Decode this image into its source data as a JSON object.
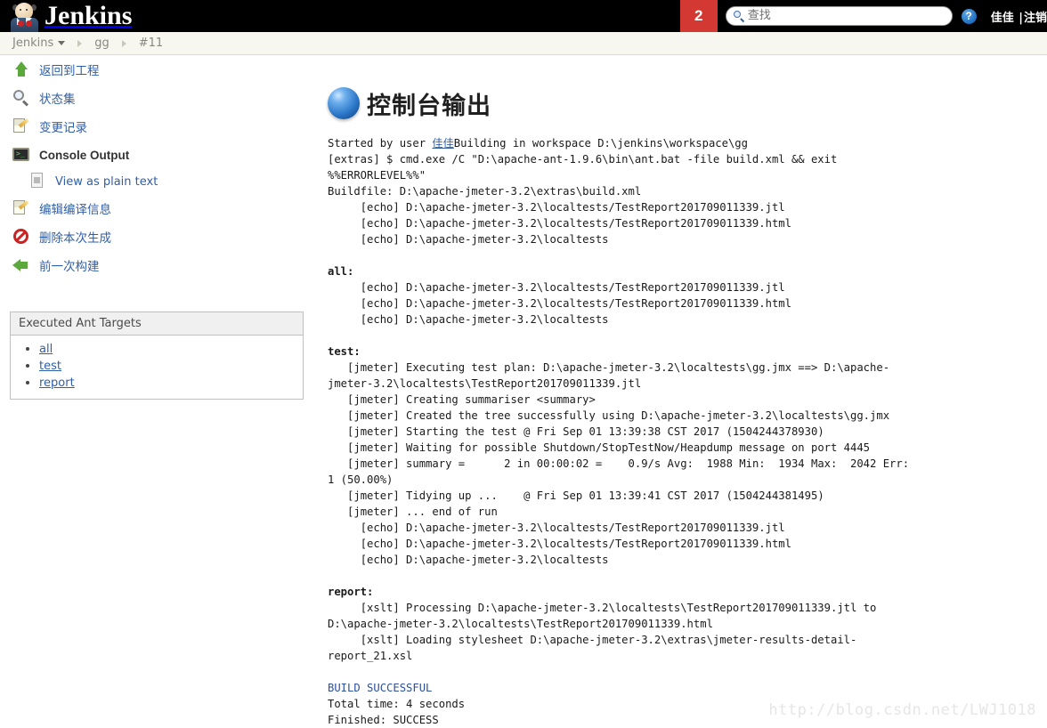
{
  "topbar": {
    "brand": "Jenkins",
    "mascot_icon": "jenkins-butler-icon",
    "build_badge": "2",
    "search_placeholder": "查找",
    "search_value": "",
    "search_icon": "search-icon",
    "help_icon": "question-mark-icon",
    "user_name": "佳佳",
    "separator": "|",
    "logout_label": "注销"
  },
  "breadcrumb": {
    "items": [
      {
        "label": "Jenkins",
        "has_caret": true
      },
      {
        "label": "gg",
        "has_caret": false
      },
      {
        "label": "#11",
        "has_caret": false
      }
    ]
  },
  "sidebar": {
    "tasks": [
      {
        "label": "返回到工程",
        "icon": "up-arrow-icon",
        "current": false
      },
      {
        "label": "状态集",
        "icon": "magnifier-icon",
        "current": false
      },
      {
        "label": "变更记录",
        "icon": "notepad-pencil-icon",
        "current": false
      },
      {
        "label": "Console Output",
        "icon": "console-terminal-icon",
        "current": true
      },
      {
        "label": "View as plain text",
        "icon": "document-icon",
        "current": false,
        "sub": true
      },
      {
        "label": "编辑编译信息",
        "icon": "notepad-pencil-icon",
        "current": false
      },
      {
        "label": "删除本次生成",
        "icon": "prohibit-icon",
        "current": false
      },
      {
        "label": "前一次构建",
        "icon": "left-arrow-icon",
        "current": false
      }
    ],
    "ant_panel": {
      "title": "Executed Ant Targets",
      "targets": [
        "all",
        "test",
        "report"
      ]
    }
  },
  "main": {
    "title": "控制台输出",
    "title_icon": "blue-sphere-icon",
    "console": {
      "started_by_prefix": "Started by user ",
      "started_by_user": "佳佳",
      "lines_1": "Building in workspace D:\\jenkins\\workspace\\gg\n[extras] $ cmd.exe /C \"D:\\apache-ant-1.9.6\\bin\\ant.bat -file build.xml && exit %%ERRORLEVEL%%\"\nBuildfile: D:\\apache-jmeter-3.2\\extras\\build.xml\n     [echo] D:\\apache-jmeter-3.2\\localtests/TestReport201709011339.jtl\n     [echo] D:\\apache-jmeter-3.2\\localtests/TestReport201709011339.html\n     [echo] D:\\apache-jmeter-3.2\\localtests\n",
      "target_all": "all:",
      "lines_all": "\n     [echo] D:\\apache-jmeter-3.2\\localtests/TestReport201709011339.jtl\n     [echo] D:\\apache-jmeter-3.2\\localtests/TestReport201709011339.html\n     [echo] D:\\apache-jmeter-3.2\\localtests\n",
      "target_test": "test:",
      "lines_test": "\n   [jmeter] Executing test plan: D:\\apache-jmeter-3.2\\localtests\\gg.jmx ==> D:\\apache-jmeter-3.2\\localtests\\TestReport201709011339.jtl\n   [jmeter] Creating summariser <summary>\n   [jmeter] Created the tree successfully using D:\\apache-jmeter-3.2\\localtests\\gg.jmx\n   [jmeter] Starting the test @ Fri Sep 01 13:39:38 CST 2017 (1504244378930)\n   [jmeter] Waiting for possible Shutdown/StopTestNow/Heapdump message on port 4445\n   [jmeter] summary =      2 in 00:00:02 =    0.9/s Avg:  1988 Min:  1934 Max:  2042 Err:     1 (50.00%)\n   [jmeter] Tidying up ...    @ Fri Sep 01 13:39:41 CST 2017 (1504244381495)\n   [jmeter] ... end of run\n     [echo] D:\\apache-jmeter-3.2\\localtests/TestReport201709011339.jtl\n     [echo] D:\\apache-jmeter-3.2\\localtests/TestReport201709011339.html\n     [echo] D:\\apache-jmeter-3.2\\localtests\n",
      "target_report": "report:",
      "lines_report": "\n     [xslt] Processing D:\\apache-jmeter-3.2\\localtests\\TestReport201709011339.jtl to D:\\apache-jmeter-3.2\\localtests\\TestReport201709011339.html\n     [xslt] Loading stylesheet D:\\apache-jmeter-3.2\\extras\\jmeter-results-detail-report_21.xsl\n",
      "build_status": "BUILD SUCCESSFUL",
      "lines_end": "\nTotal time: 4 seconds\nFinished: SUCCESS"
    }
  },
  "watermark": "http://blog.csdn.net/LWJ1018"
}
